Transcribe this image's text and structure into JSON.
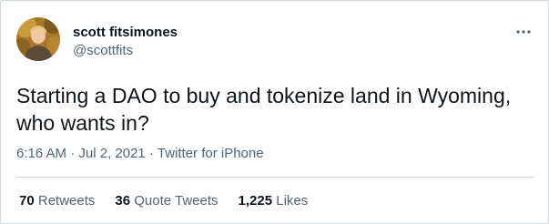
{
  "author": {
    "display_name": "scott fitsimones",
    "handle": "@scottfits"
  },
  "tweet": {
    "text": "Starting a DAO to buy and tokenize land in Wyoming, who wants in?",
    "time": "6:16 AM",
    "date": "Jul 2, 2021",
    "source": "Twitter for iPhone",
    "separator": "·"
  },
  "stats": {
    "retweets_count": "70",
    "retweets_label": "Retweets",
    "quote_count": "36",
    "quote_label": "Quote Tweets",
    "likes_count": "1,225",
    "likes_label": "Likes"
  },
  "icons": {
    "more": "more-horizontal-icon"
  },
  "colors": {
    "text_primary": "#0f1419",
    "text_secondary": "#536471",
    "border": "#cfd9de"
  }
}
